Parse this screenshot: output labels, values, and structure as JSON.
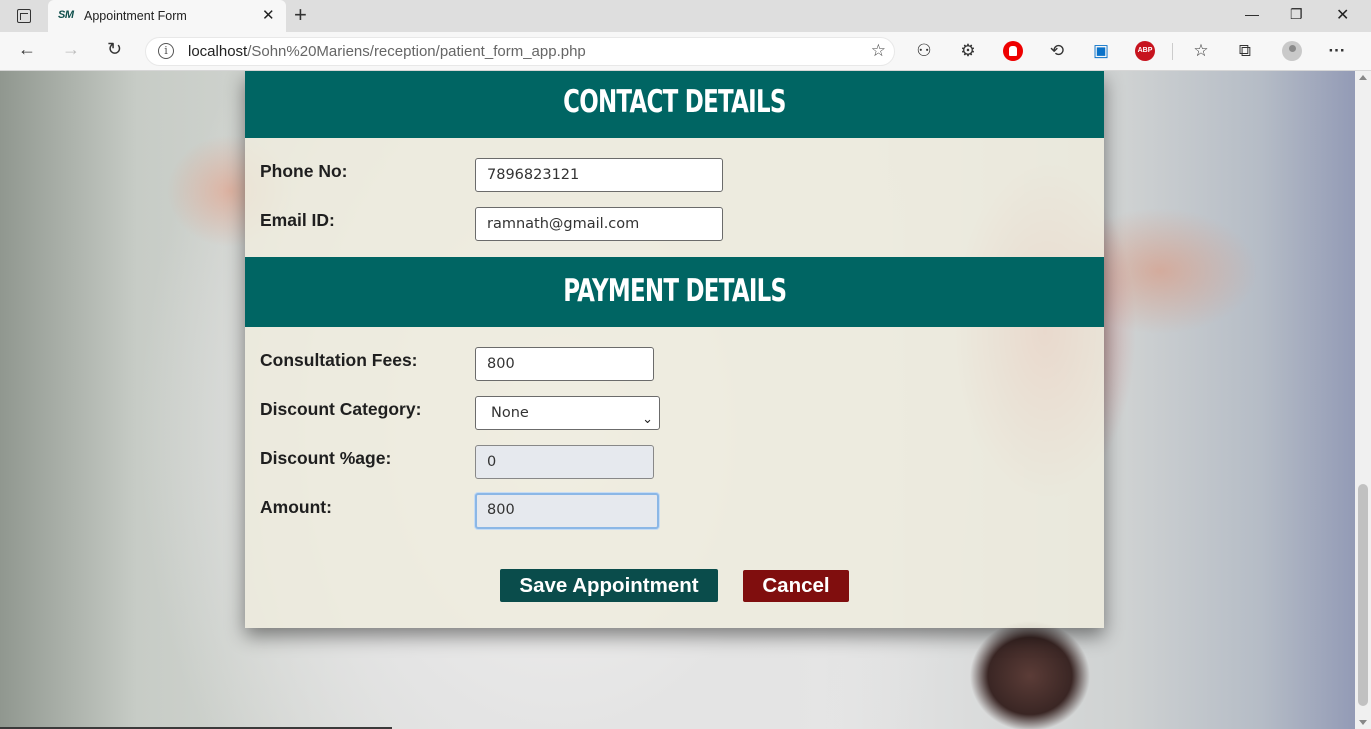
{
  "browser": {
    "tab": {
      "favicon_text": "SM",
      "title": "Appointment Form",
      "close_glyph": "✕"
    },
    "new_tab_glyph": "+",
    "window_controls": {
      "minimize": "—",
      "restore": "❐",
      "close": "✕"
    },
    "nav": {
      "back": "←",
      "forward": "→",
      "refresh": "↻"
    },
    "address": {
      "host": "localhost",
      "path": "/Sohn%20Mariens/reception/patient_form_app.php",
      "info_glyph": "i",
      "favorite_glyph": "☆"
    },
    "toolbar": {
      "favorites_glyph": "☆",
      "collections_glyph": "⧉",
      "more_glyph": "···",
      "abp_label": "ABP"
    }
  },
  "form": {
    "contact_section": {
      "title": "CONTACT DETAILS",
      "phone_label": "Phone No:",
      "phone_value": "7896823121",
      "email_label": "Email ID:",
      "email_value": "ramnath@gmail.com"
    },
    "payment_section": {
      "title": "PAYMENT DETAILS",
      "fees_label": "Consultation Fees:",
      "fees_value": "800",
      "discount_category_label": "Discount Category:",
      "discount_category_value": "None",
      "discount_pct_label": "Discount %age:",
      "discount_pct_value": "0",
      "amount_label": "Amount:",
      "amount_value": "800"
    },
    "buttons": {
      "save": "Save Appointment",
      "cancel": "Cancel"
    }
  },
  "colors": {
    "header_teal": "#006563",
    "save_button": "#0a4c4b",
    "cancel_button": "#800e0e"
  }
}
